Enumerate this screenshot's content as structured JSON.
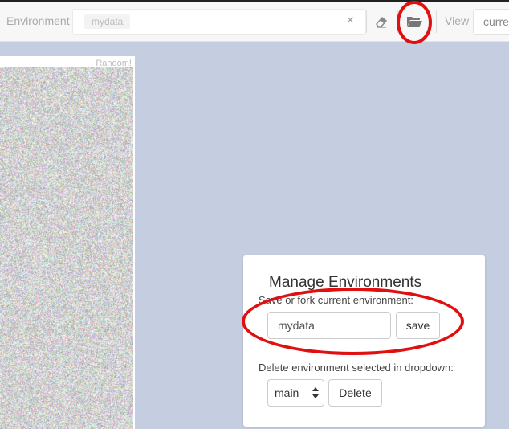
{
  "toolbar": {
    "environment_label": "Environment",
    "environment_tag": "mydata",
    "clear_symbol": "×",
    "view_label": "View",
    "view_value": "current",
    "icons": [
      "eraser-icon",
      "folder-open-icon"
    ]
  },
  "pane": {
    "title": "Random!"
  },
  "modal": {
    "title": "Manage Environments",
    "save_label": "Save or fork current environment:",
    "env_name_value": "mydata",
    "save_button": "save",
    "delete_label": "Delete environment selected in dropdown:",
    "selected_env": "main",
    "delete_button": "Delete"
  },
  "annotation_color": "#e01010"
}
